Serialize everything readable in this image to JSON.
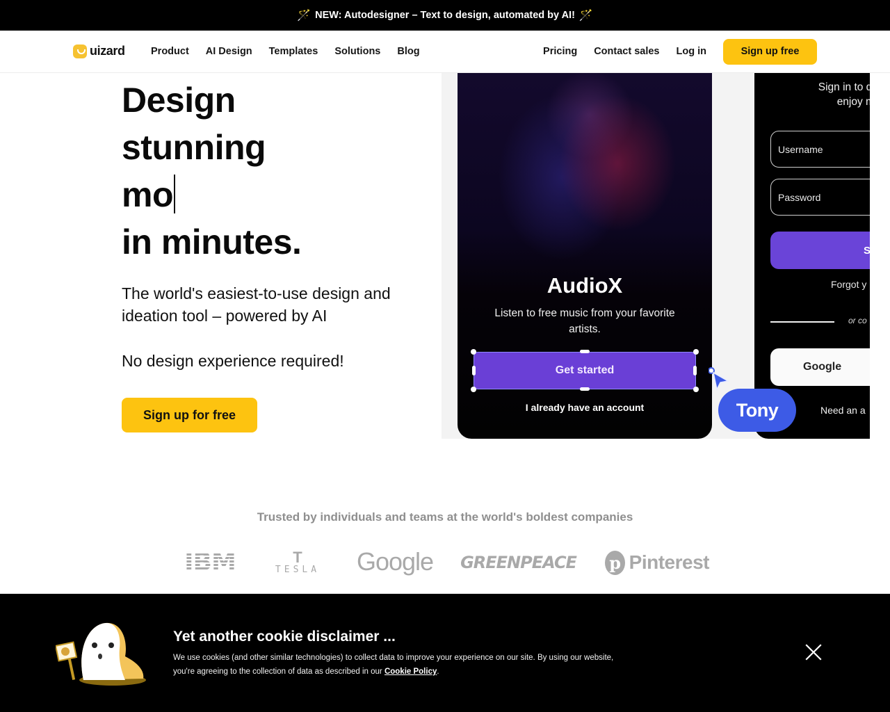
{
  "announcement": {
    "icon": "magic-wand-icon",
    "text": "NEW: Autodesigner – Text to design, automated by AI!"
  },
  "nav": {
    "brand": "uizard",
    "links": [
      "Product",
      "AI Design",
      "Templates",
      "Solutions",
      "Blog"
    ],
    "right_links": [
      "Pricing",
      "Contact sales",
      "Log in"
    ],
    "signup_label": "Sign up free"
  },
  "hero": {
    "title_lines": [
      "Design",
      "stunning",
      "mo",
      "in minutes."
    ],
    "subtitle": "The world's easiest-to-use design and ideation tool – powered by AI",
    "subtitle2": "No design experience required!",
    "cta_label": "Sign up for free"
  },
  "showcase": {
    "app1": {
      "title": "AudioX",
      "description": "Listen to free music from your favorite artists.",
      "primary_button": "Get started",
      "secondary_link": "I already have an account"
    },
    "app2": {
      "heading_line1": "Sign in to disc",
      "heading_line2": "enjoy mill",
      "username_placeholder": "Username",
      "password_placeholder": "Password",
      "signin_button": "S",
      "forgot_link": "Forgot y",
      "divider_text": "or co",
      "google_button": "Google",
      "signup_link": "Need an a"
    },
    "collaborator_name": "Tony"
  },
  "trusted": {
    "heading": "Trusted by individuals and teams at the world's boldest companies",
    "companies": [
      "IBM",
      "TESLA",
      "Google",
      "GREENPEACE",
      "Pinterest"
    ]
  },
  "cookie": {
    "title": "Yet another cookie disclaimer ...",
    "text": "We use cookies (and other similar technologies) to collect data to improve your experience on our site. By using our website, you're agreeing to the collection of data as described in our ",
    "link": "Cookie Policy",
    "suffix": "."
  },
  "colors": {
    "brand_yellow": "#fdc310",
    "accent_purple": "#6a3fd6",
    "collaborator_blue": "#3d5be6"
  }
}
